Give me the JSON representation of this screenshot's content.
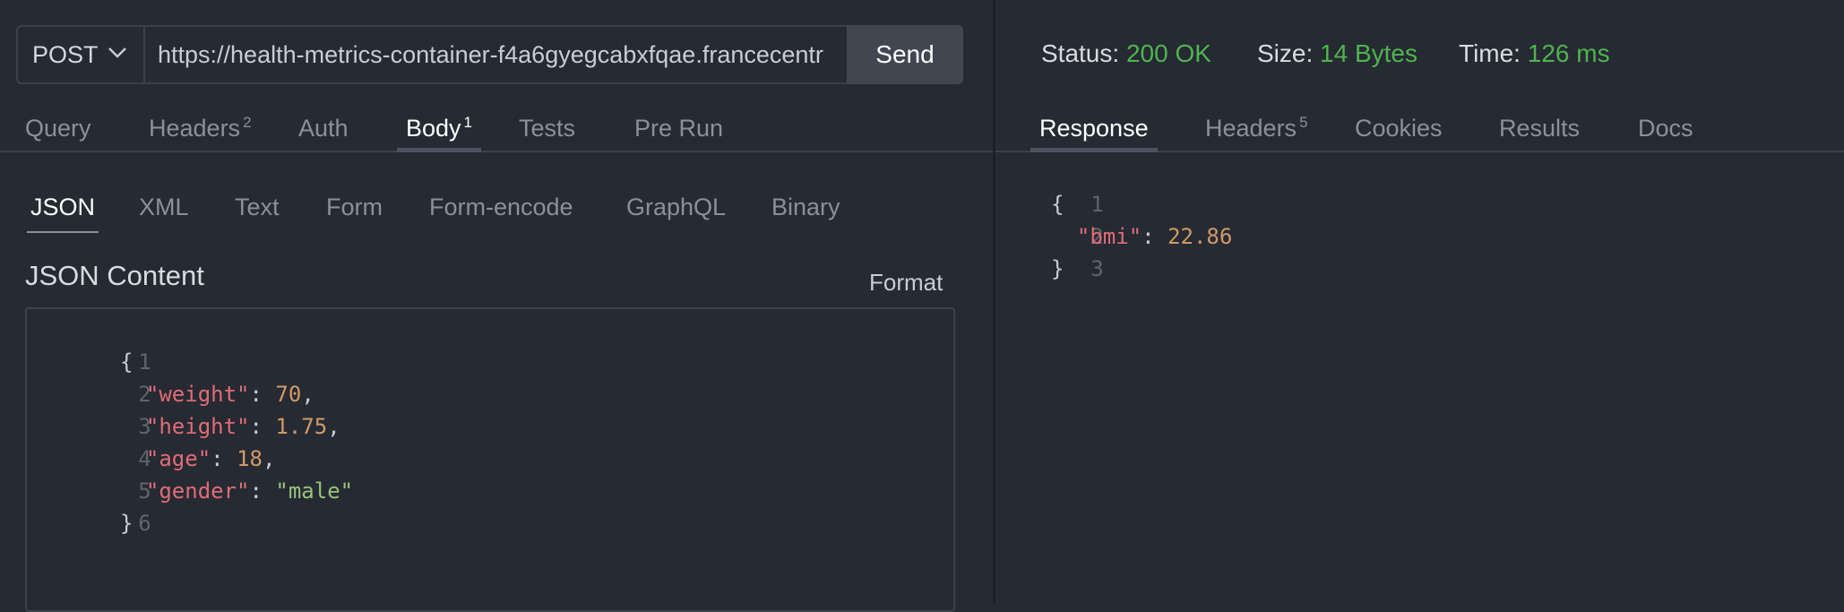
{
  "request": {
    "method": "POST",
    "url": "https://health-metrics-container-f4a6gyegcabxfqae.francecentr",
    "send_label": "Send",
    "tabs": [
      {
        "label": "Query",
        "badge": ""
      },
      {
        "label": "Headers",
        "badge": "2"
      },
      {
        "label": "Auth",
        "badge": ""
      },
      {
        "label": "Body",
        "badge": "1"
      },
      {
        "label": "Tests",
        "badge": ""
      },
      {
        "label": "Pre Run",
        "badge": ""
      }
    ],
    "active_tab": "Body",
    "body_types": [
      "JSON",
      "XML",
      "Text",
      "Form",
      "Form-encode",
      "GraphQL",
      "Binary"
    ],
    "active_body_type": "JSON",
    "content_title": "JSON Content",
    "format_label": "Format",
    "body_lines": [
      {
        "n": "1",
        "indent": "",
        "key": "",
        "sep": "",
        "value": "{",
        "vtype": "punc",
        "trail": ""
      },
      {
        "n": "2",
        "indent": "  ",
        "key": "\"weight\"",
        "sep": ": ",
        "value": "70",
        "vtype": "num",
        "trail": ","
      },
      {
        "n": "3",
        "indent": "  ",
        "key": "\"height\"",
        "sep": ": ",
        "value": "1.75",
        "vtype": "num",
        "trail": ","
      },
      {
        "n": "4",
        "indent": "  ",
        "key": "\"age\"",
        "sep": ": ",
        "value": "18",
        "vtype": "num",
        "trail": ","
      },
      {
        "n": "5",
        "indent": "  ",
        "key": "\"gender\"",
        "sep": ": ",
        "value": "\"male\"",
        "vtype": "str",
        "trail": ""
      },
      {
        "n": "6",
        "indent": "",
        "key": "",
        "sep": "",
        "value": "}",
        "vtype": "punc",
        "trail": ""
      }
    ]
  },
  "response": {
    "status_label": "Status:",
    "status_value": "200 OK",
    "size_label": "Size:",
    "size_value": "14 Bytes",
    "time_label": "Time:",
    "time_value": "126 ms",
    "status_color": "#4fb44f",
    "tabs": [
      {
        "label": "Response",
        "badge": ""
      },
      {
        "label": "Headers",
        "badge": "5"
      },
      {
        "label": "Cookies",
        "badge": ""
      },
      {
        "label": "Results",
        "badge": ""
      },
      {
        "label": "Docs",
        "badge": ""
      }
    ],
    "active_tab": "Response",
    "body_lines": [
      {
        "n": "1",
        "indent": "",
        "key": "",
        "sep": "",
        "value": "{",
        "vtype": "punc",
        "trail": ""
      },
      {
        "n": "2",
        "indent": "  ",
        "key": "\"bmi\"",
        "sep": ": ",
        "value": "22.86",
        "vtype": "num",
        "trail": ""
      },
      {
        "n": "3",
        "indent": "",
        "key": "",
        "sep": "",
        "value": "}",
        "vtype": "punc",
        "trail": ""
      }
    ]
  }
}
